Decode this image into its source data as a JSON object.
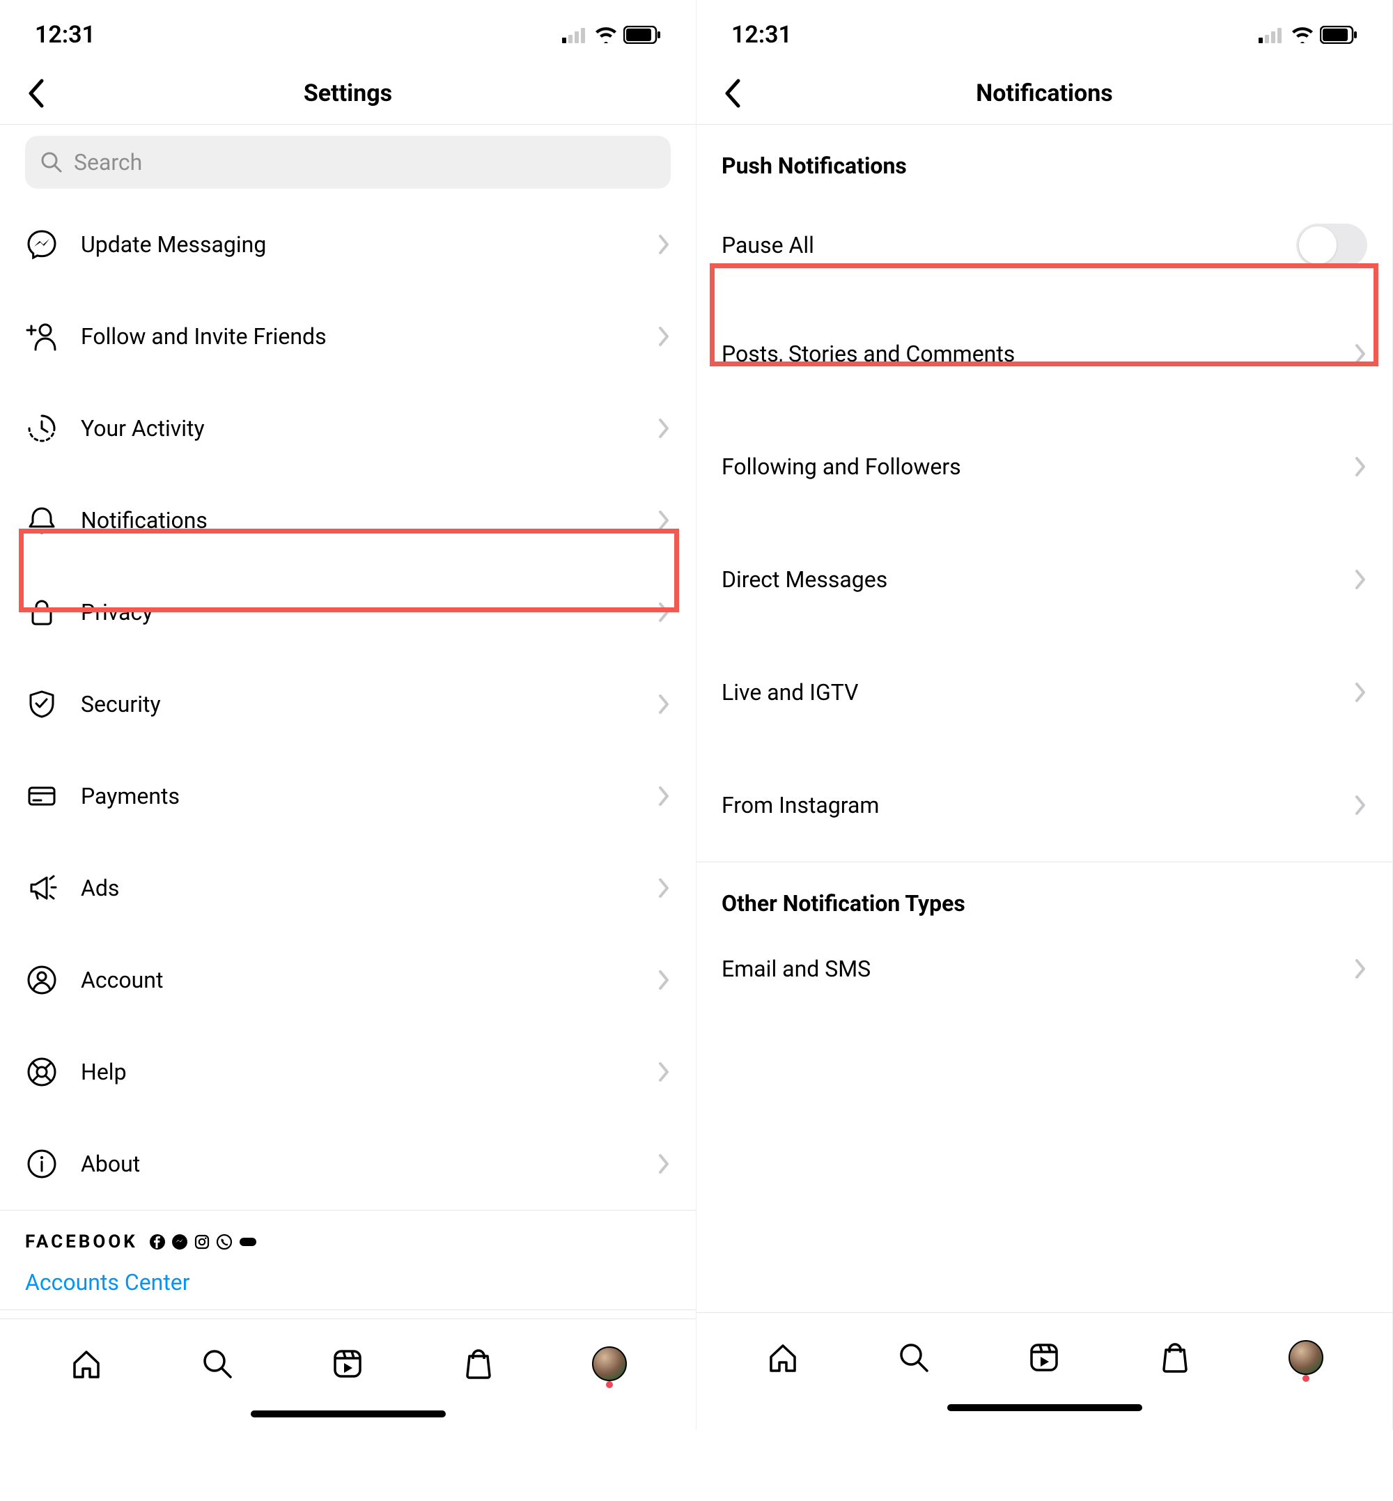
{
  "status": {
    "time": "12:31"
  },
  "left": {
    "title": "Settings",
    "search_placeholder": "Search",
    "items": [
      {
        "id": "update-messaging",
        "label": "Update Messaging"
      },
      {
        "id": "follow-invite",
        "label": "Follow and Invite Friends"
      },
      {
        "id": "your-activity",
        "label": "Your Activity"
      },
      {
        "id": "notifications",
        "label": "Notifications",
        "highlighted": true
      },
      {
        "id": "privacy",
        "label": "Privacy"
      },
      {
        "id": "security",
        "label": "Security"
      },
      {
        "id": "payments",
        "label": "Payments"
      },
      {
        "id": "ads",
        "label": "Ads"
      },
      {
        "id": "account",
        "label": "Account"
      },
      {
        "id": "help",
        "label": "Help"
      },
      {
        "id": "about",
        "label": "About"
      }
    ],
    "footer": {
      "brand": "FACEBOOK",
      "accounts_center": "Accounts Center"
    }
  },
  "right": {
    "title": "Notifications",
    "sections": [
      {
        "title": "Push Notifications",
        "items": [
          {
            "id": "pause-all",
            "label": "Pause All",
            "type": "toggle",
            "value": false,
            "highlighted": true
          },
          {
            "id": "posts-stories-comments",
            "label": "Posts, Stories and Comments",
            "type": "nav"
          },
          {
            "id": "following-followers",
            "label": "Following and Followers",
            "type": "nav"
          },
          {
            "id": "direct-messages",
            "label": "Direct Messages",
            "type": "nav"
          },
          {
            "id": "live-igtv",
            "label": "Live and IGTV",
            "type": "nav"
          },
          {
            "id": "from-instagram",
            "label": "From Instagram",
            "type": "nav"
          }
        ]
      },
      {
        "title": "Other Notification Types",
        "items": [
          {
            "id": "email-sms",
            "label": "Email and SMS",
            "type": "nav"
          }
        ]
      }
    ]
  },
  "highlight_color": "#f05a50"
}
